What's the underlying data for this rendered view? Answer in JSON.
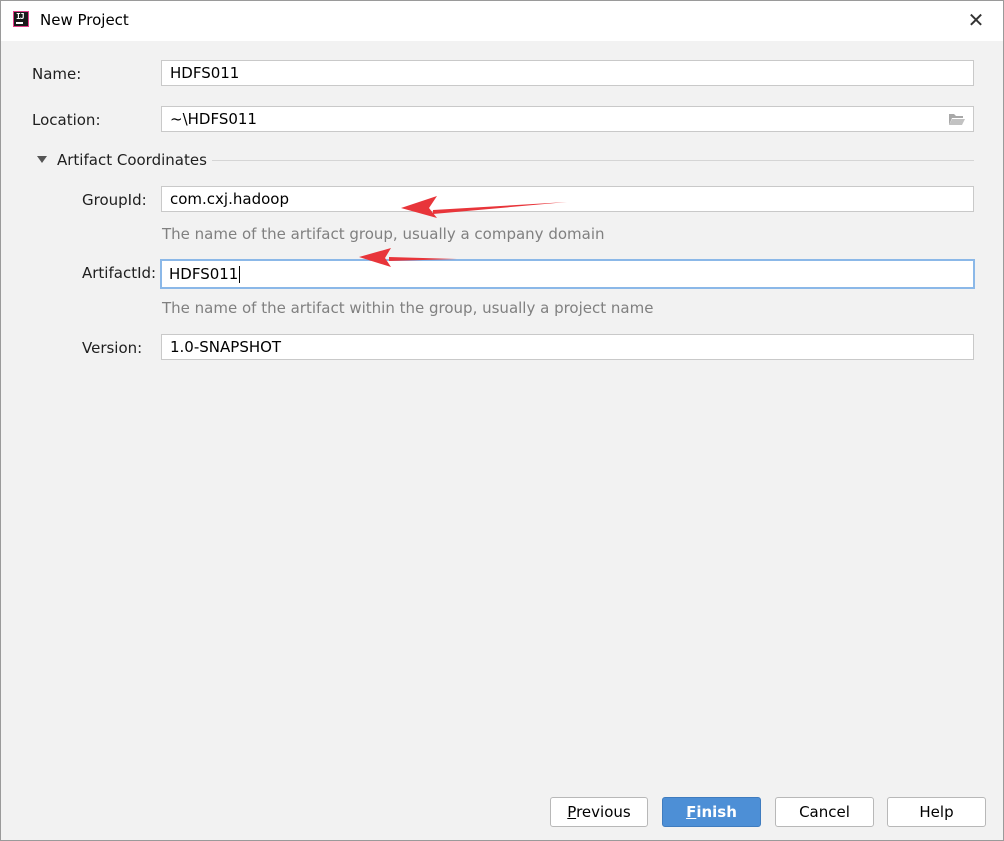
{
  "window": {
    "title": "New Project",
    "close_label": "✕"
  },
  "form": {
    "name": {
      "label": "Name:",
      "value": "HDFS011"
    },
    "location": {
      "label": "Location:",
      "value": "~\\HDFS011"
    },
    "section": {
      "label": "Artifact Coordinates",
      "expanded": true
    },
    "group_id": {
      "label": "GroupId:",
      "value": "com.cxj.hadoop",
      "hint": "The name of the artifact group, usually a company domain"
    },
    "artifact_id": {
      "label": "ArtifactId:",
      "value": "HDFS011",
      "hint": "The name of the artifact within the group, usually a project name"
    },
    "version": {
      "label": "Version:",
      "value": "1.0-SNAPSHOT"
    }
  },
  "buttons": {
    "previous": {
      "mnemonic": "P",
      "rest": "revious"
    },
    "finish": {
      "mnemonic": "F",
      "rest": "inish"
    },
    "cancel": "Cancel",
    "help": "Help"
  },
  "annotation_color": "#e8353a",
  "accent_color": "#4d8fd6"
}
